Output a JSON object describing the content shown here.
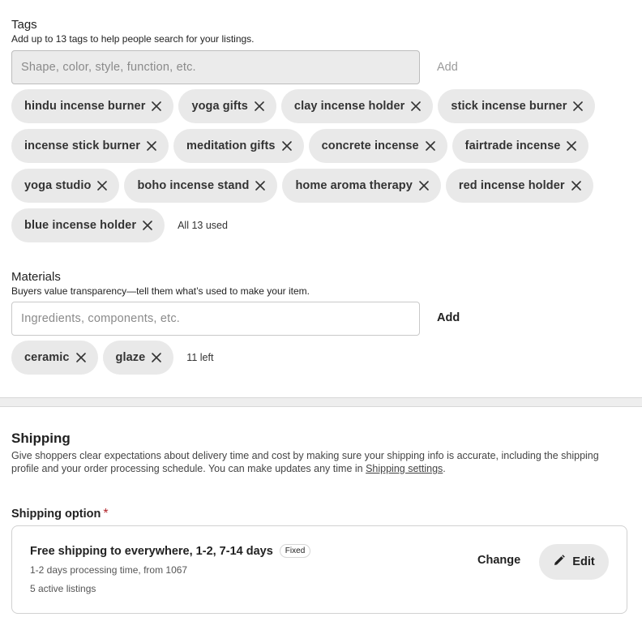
{
  "tags": {
    "title": "Tags",
    "description": "Add up to 13 tags to help people search for your listings.",
    "input_placeholder": "Shape, color, style, function, etc.",
    "add_label": "Add",
    "items": [
      "hindu incense burner",
      "yoga gifts",
      "clay incense holder",
      "stick incense burner",
      "incense stick burner",
      "meditation gifts",
      "concrete incense",
      "fairtrade incense",
      "yoga studio",
      "boho incense stand",
      "home aroma therapy",
      "red incense holder",
      "blue incense holder"
    ],
    "count_text": "All 13 used"
  },
  "materials": {
    "title": "Materials",
    "description": "Buyers value transparency—tell them what’s used to make your item.",
    "input_placeholder": "Ingredients, components, etc.",
    "add_label": "Add",
    "items": [
      "ceramic",
      "glaze"
    ],
    "count_text": "11 left"
  },
  "shipping": {
    "title": "Shipping",
    "description": "Give shoppers clear expectations about delivery time and cost by making sure your shipping info is accurate, including the shipping profile and your order processing schedule. You can make updates any time in ",
    "settings_link": "Shipping settings",
    "description_end": ".",
    "option_label": "Shipping option",
    "required_mark": "*",
    "card": {
      "title": "Free shipping to everywhere, 1-2, 7-14 days",
      "badge": "Fixed",
      "processing": "1-2 days processing time, from 1067",
      "listings": "5 active listings",
      "change_label": "Change",
      "edit_label": "Edit"
    }
  },
  "icons": {
    "remove": "close-icon",
    "edit": "pencil-icon"
  }
}
